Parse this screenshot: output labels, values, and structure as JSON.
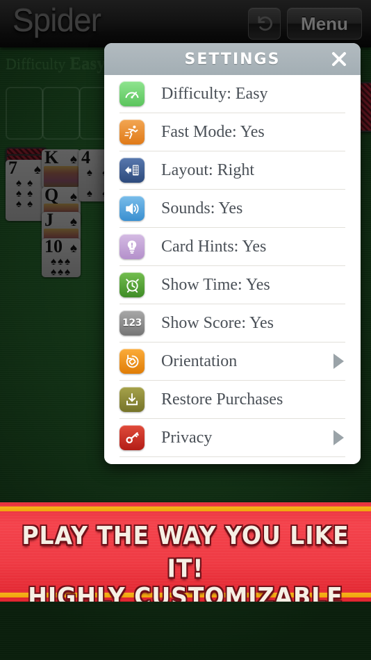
{
  "app": {
    "title": "Spider",
    "background_color": "#102e13"
  },
  "topbar": {
    "logo": "Spider",
    "undo_icon": "undo-arrow-icon",
    "menu_label": "Menu"
  },
  "game_status": {
    "difficulty_label": "Difficulty",
    "difficulty_value": "Easy"
  },
  "board": {
    "empty_slots": 3,
    "cards": [
      {
        "rank": "7",
        "suit": "♠",
        "face": false
      },
      {
        "rank": "K",
        "suit": "♠",
        "face": true
      },
      {
        "rank": "Q",
        "suit": "♠",
        "face": true
      },
      {
        "rank": "J",
        "suit": "♠",
        "face": true
      },
      {
        "rank": "10",
        "suit": "♠",
        "face": false
      },
      {
        "rank": "4",
        "suit": "♠",
        "face": false
      }
    ]
  },
  "dialog": {
    "title": "SETTINGS",
    "close_icon": "close-icon",
    "rows": [
      {
        "label": "Difficulty: Easy",
        "icon": "gauge-icon",
        "icon_color": "#6dd46f",
        "chevron": false
      },
      {
        "label": "Fast Mode: Yes",
        "icon": "runner-icon",
        "icon_color": "#ec8b2b",
        "chevron": false
      },
      {
        "label": "Layout: Right",
        "icon": "layout-left-icon",
        "icon_color": "#3d5f96",
        "chevron": false
      },
      {
        "label": "Sounds: Yes",
        "icon": "speaker-icon",
        "icon_color": "#54a5e0",
        "chevron": false
      },
      {
        "label": "Card Hints: Yes",
        "icon": "lightbulb-icon",
        "icon_color": "#c4a3d6",
        "chevron": false
      },
      {
        "label": "Show Time: Yes",
        "icon": "alarm-clock-icon",
        "icon_color": "#55a337",
        "chevron": false
      },
      {
        "label": "Show Score: Yes",
        "icon": "numbers-123-icon",
        "icon_color": "#8f8f8f",
        "chevron": false
      },
      {
        "label": "Orientation",
        "icon": "rotate-icon",
        "icon_color": "#f09213",
        "chevron": true
      },
      {
        "label": "Restore Purchases",
        "icon": "download-icon",
        "icon_color": "#8e8b38",
        "chevron": false
      },
      {
        "label": "Privacy",
        "icon": "key-icon",
        "icon_color": "#cc2a22",
        "chevron": true
      }
    ]
  },
  "banner": {
    "line1": "PLAY THE WAY YOU LIKE IT!",
    "line2": "HIGHLY CUSTOMIZABLE SETTINGS",
    "background_color": "#ef3b44",
    "stripe_color": "#f5b21b",
    "text_color": "#f6efe4"
  }
}
